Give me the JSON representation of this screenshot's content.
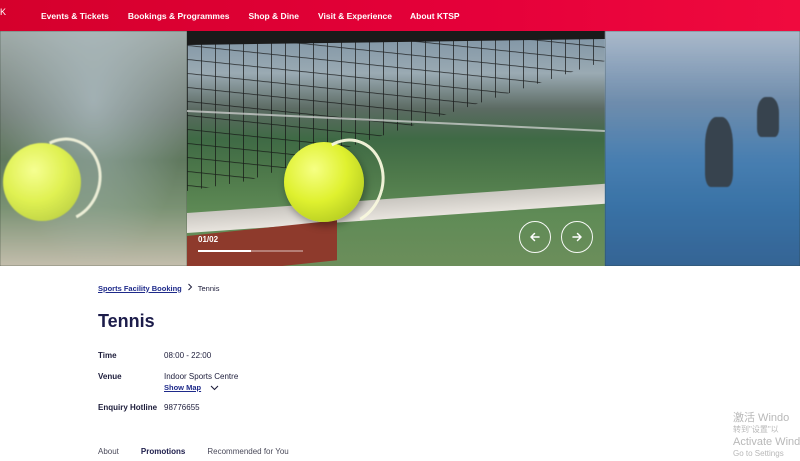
{
  "nav": {
    "edge_glyph": "K",
    "items": [
      {
        "label": "Events & Tickets"
      },
      {
        "label": "Bookings & Programmes"
      },
      {
        "label": "Shop & Dine"
      },
      {
        "label": "Visit & Experience"
      },
      {
        "label": "About KTSP"
      }
    ]
  },
  "carousel": {
    "counter": "01/02",
    "progress_fraction": 0.5
  },
  "breadcrumb": {
    "parent": "Sports Facility Booking",
    "current": "Tennis"
  },
  "page_title": "Tennis",
  "details": {
    "time_label": "Time",
    "time_value": "08:00 - 22:00",
    "venue_label": "Venue",
    "venue_value": "Indoor Sports Centre",
    "show_map": "Show Map",
    "hotline_label": "Enquiry Hotline",
    "hotline_value": "98776655"
  },
  "tabs": [
    {
      "label": "About"
    },
    {
      "label": "Promotions"
    },
    {
      "label": "Recommended for You"
    }
  ],
  "watermark": {
    "line1": "激活 Windo",
    "line2": "转到\"设置\"以",
    "line3": "Activate Windo",
    "line4": "Go to Settings"
  },
  "colors": {
    "nav_red": "#e5003a",
    "link_blue": "#1e2a8a",
    "title_navy": "#1c1c4a"
  }
}
